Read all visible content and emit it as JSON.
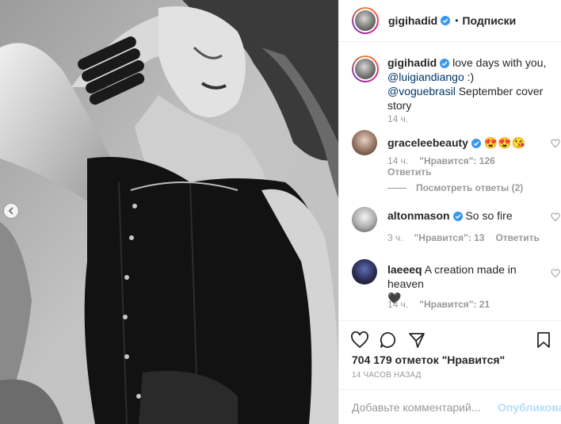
{
  "header": {
    "username": "gigihadid",
    "dot": "•",
    "follow_label": "Подписки"
  },
  "caption": {
    "username": "gigihadid",
    "text_1": "love days with you,",
    "mention_1": "@luigiandiango",
    "text_2": ":)",
    "mention_2": "@voguebrasil",
    "text_3": "September cover story",
    "time": "14 ч."
  },
  "comments": [
    {
      "username": "graceleebeauty",
      "text": "😍😍😘",
      "time": "14 ч.",
      "likes": "\"Нравится\": 126",
      "reply": "Ответить",
      "verified": true
    },
    {
      "username": "altonmason",
      "text": "So so fire",
      "time": "3 ч.",
      "likes": "\"Нравится\": 13",
      "reply": "Ответить",
      "verified": true
    },
    {
      "username": "laeeeq",
      "text": "A creation made in heaven",
      "emoji": "🖤",
      "time": "14 ч.",
      "likes": "\"Нравится\": 21",
      "reply": "",
      "verified": false
    }
  ],
  "view_replies": "Посмотреть ответы (2)",
  "likes_count": "704 179 отметок \"Нравится\"",
  "time_ago": "14 ЧАСОВ НАЗАД",
  "add_comment": {
    "placeholder": "Добавьте комментарий...",
    "publish_label": "Опубликовать"
  },
  "colors": {
    "verified": "#3897f0",
    "link": "#003569",
    "muted": "#999999",
    "publish_disabled": "#b2dffc"
  }
}
